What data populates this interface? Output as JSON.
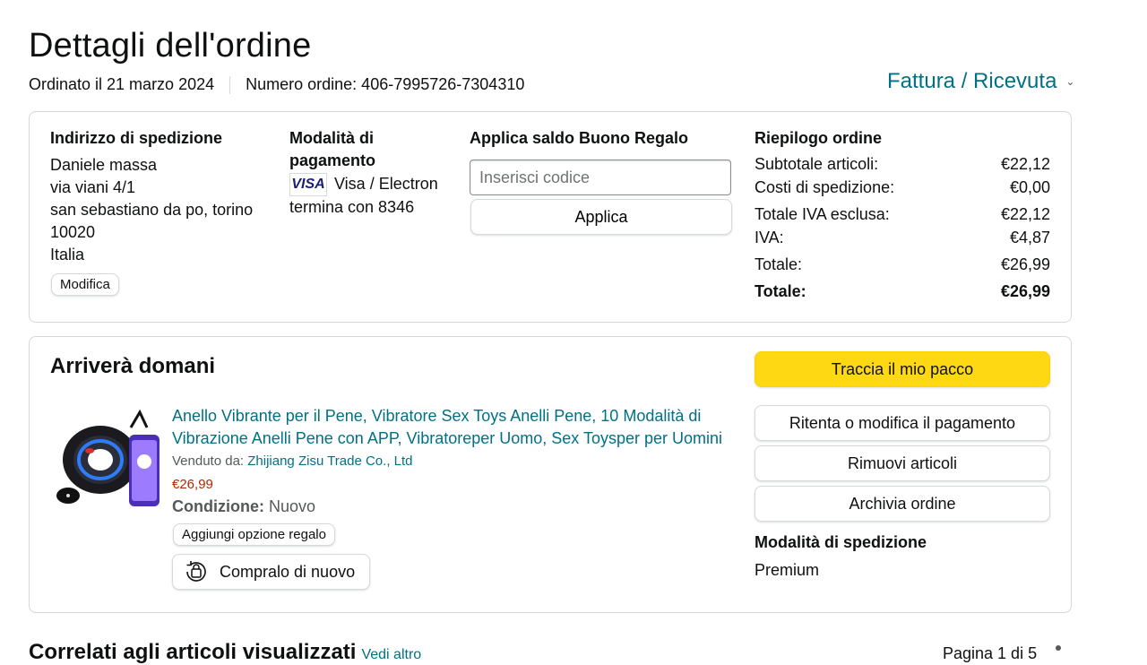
{
  "page": {
    "title": "Dettagli dell'ordine",
    "ordered_on": "Ordinato il 21 marzo 2024",
    "order_number": "Numero ordine: 406-7995726-7304310",
    "invoice_link": "Fattura / Ricevuta"
  },
  "shipping": {
    "heading": "Indirizzo di spedizione",
    "lines": [
      "Daniele massa",
      "via viani 4/1",
      "san sebastiano da po, torino",
      "10020",
      "Italia"
    ],
    "edit_label": "Modifica"
  },
  "payment": {
    "heading_line1": "Modalità di",
    "heading_line2": "pagamento",
    "card_logo_text": "VISA",
    "card_name": "Visa / Electron",
    "card_end": "termina con 8346"
  },
  "gift": {
    "heading": "Applica saldo Buono Regalo",
    "placeholder": "Inserisci codice",
    "apply_label": "Applica"
  },
  "summary": {
    "heading": "Riepilogo ordine",
    "rows": [
      {
        "label": "Subtotale articoli:",
        "value": "€22,12"
      },
      {
        "label": "Costi di spedizione:",
        "value": "€0,00"
      },
      {
        "label": "Totale IVA esclusa:",
        "value": "€22,12"
      },
      {
        "label": "IVA:",
        "value": "€4,87"
      },
      {
        "label": "Totale:",
        "value": "€26,99"
      },
      {
        "label": "Totale:",
        "value": "€26,99"
      }
    ]
  },
  "delivery": {
    "heading": "Arriverà domani",
    "product_title": "Anello Vibrante per il Pene, Vibratore Sex Toys Anelli Pene, 10 Modalità di Vibrazione Anelli Pene con APP, Vibratoreper Uomo, Sex Toysper per Uomini",
    "sold_by_label": "Venduto da:",
    "seller": "Zhijiang Zisu Trade Co., Ltd",
    "price": "€26,99",
    "condition_label": "Condizione:",
    "condition_value": "Nuovo",
    "gift_option_label": "Aggiungi opzione regalo",
    "buy_again_label": "Compralo di nuovo",
    "actions": {
      "track": "Traccia il mio pacco",
      "retry_payment": "Ritenta o modifica il pagamento",
      "remove": "Rimuovi articoli",
      "archive": "Archivia ordine"
    },
    "shipping_mode_heading": "Modalità di spedizione",
    "shipping_mode_value": "Premium"
  },
  "related": {
    "title": "Correlati agli articoli visualizzati",
    "see_more": "Vedi altro",
    "page_indicator": "Pagina 1 di 5"
  },
  "colors": {
    "link": "#007185",
    "primary_button": "#ffd814",
    "price": "#b12704",
    "border": "#d5d9d9"
  }
}
